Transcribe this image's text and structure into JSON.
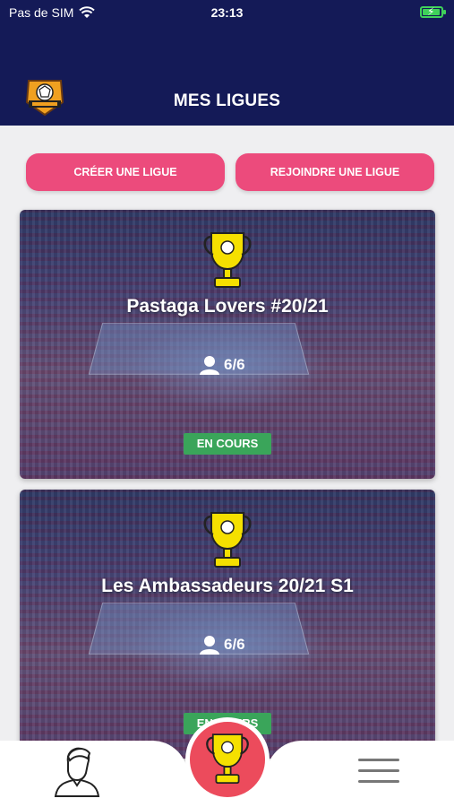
{
  "status_bar": {
    "carrier": "Pas de SIM",
    "time": "23:13",
    "battery_level": 0.85
  },
  "header": {
    "title": "MES LIGUES",
    "logo_icon": "handball-club-logo"
  },
  "actions": {
    "create_label": "CRÉER UNE LIGUE",
    "join_label": "REJOINDRE UNE LIGUE"
  },
  "leagues": [
    {
      "name": "Pastaga Lovers #20/21",
      "members": "6/6",
      "status": "EN COURS"
    },
    {
      "name": "Les Ambassadeurs 20/21 S1",
      "members": "6/6",
      "status": "EN COURS"
    }
  ],
  "tabbar": {
    "left_icon": "profile-icon",
    "center_icon": "trophy-icon",
    "right_icon": "menu-icon"
  },
  "colors": {
    "header_bg": "#141a57",
    "accent": "#ec4b7c",
    "status_green": "#3aa55a",
    "trophy": "#f5e000"
  }
}
